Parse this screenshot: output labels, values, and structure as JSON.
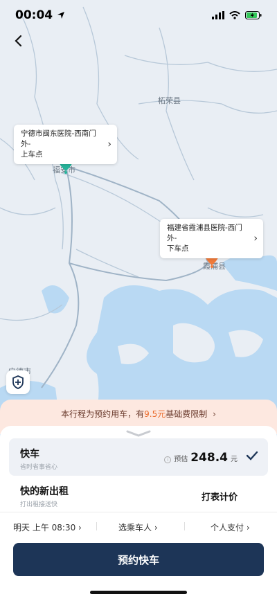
{
  "status_bar": {
    "time": "00:04"
  },
  "map": {
    "places": [
      "柘荣县",
      "福安市",
      "霞浦县",
      "宁德市"
    ],
    "pickup": {
      "name": "宁德市闽东医院-西南门外-",
      "tag": "上车点"
    },
    "dropoff": {
      "name": "福建省霞浦县医院-西门外-",
      "tag": "下车点"
    }
  },
  "notice": {
    "prefix": "本行程为预约用车，有",
    "amount": "9.5元",
    "suffix": "基础费限制",
    "arrow": "›"
  },
  "ride_options": [
    {
      "title": "快车",
      "subtitle": "省时省事省心",
      "estimate_label": "预估",
      "price": "248.4",
      "unit": "元",
      "selected": true
    },
    {
      "title": "快的新出租",
      "subtitle": "打出租接送快",
      "pricing": "打表计价",
      "selected": false
    }
  ],
  "prefs": {
    "time": "明天 上午 08:30 ›",
    "passenger": "选乘车人 ›",
    "payment": "个人支付 ›"
  },
  "book_button": {
    "label": "预约快车"
  },
  "colors": {
    "primary": "#1d3557",
    "pickup_pin": "#26b39a",
    "dropoff_pin": "#f07a3a",
    "notice_bg": "#fde8e0",
    "water": "#b9d9f3"
  }
}
